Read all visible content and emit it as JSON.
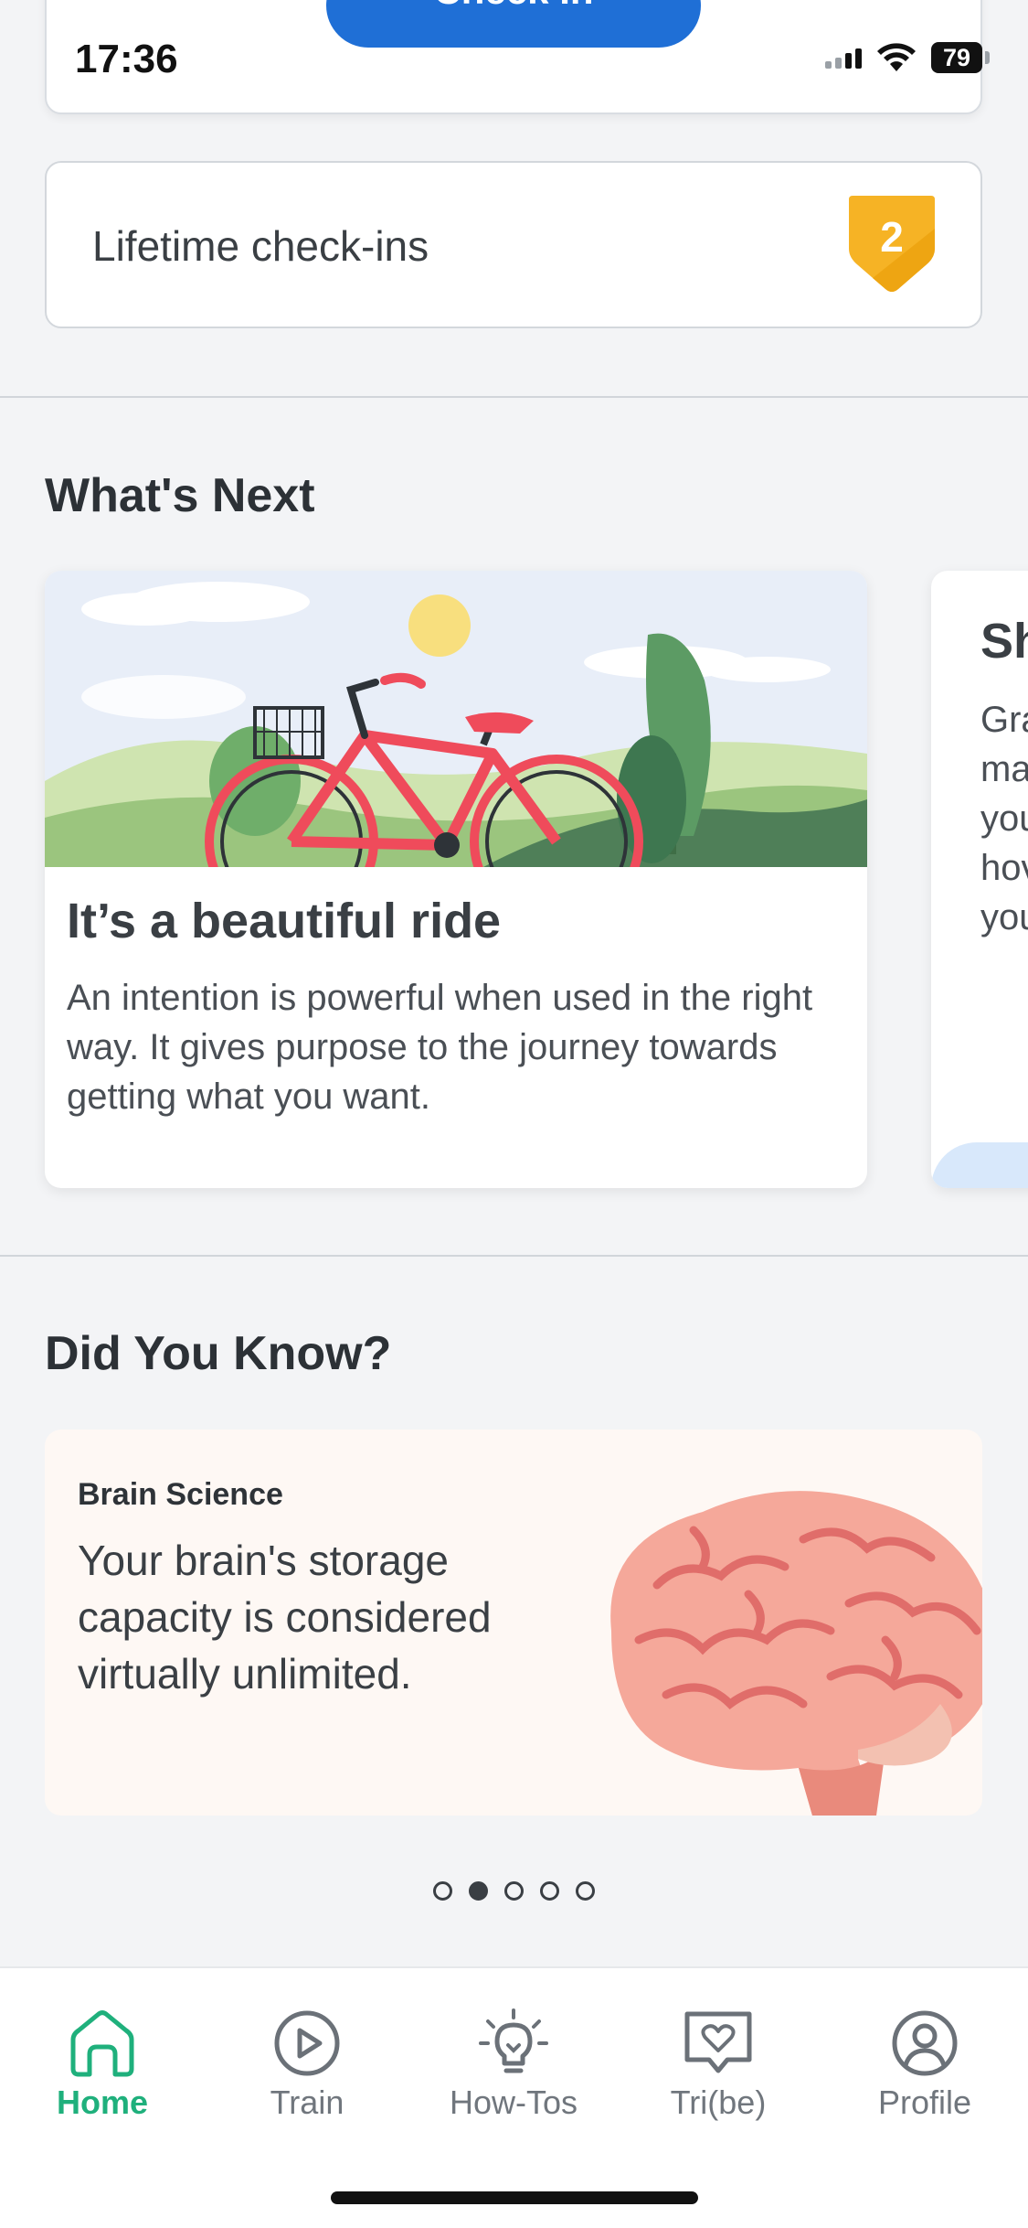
{
  "status_bar": {
    "time": "17:36",
    "battery": "79"
  },
  "checkin": {
    "button_label": "Check In"
  },
  "lifetime": {
    "label": "Lifetime check-ins",
    "count": "2"
  },
  "whats_next": {
    "title": "What's Next",
    "cards": [
      {
        "title": "It’s a beautiful ride",
        "body": "An intention is powerful when used in the right way. It gives purpose to the journey towards getting what you want."
      },
      {
        "title": "Sh",
        "body": "Gra\nma\nyou\nhov\nyou"
      }
    ]
  },
  "did_you_know": {
    "title": "Did You Know?",
    "card": {
      "category": "Brain Science",
      "text": "Your brain's storage capacity is considered virtually unlimited."
    },
    "pager": {
      "count": 5,
      "active_index": 1
    }
  },
  "tabbar": {
    "tabs": [
      {
        "label": "Home",
        "icon": "home-icon",
        "active": true
      },
      {
        "label": "Train",
        "icon": "play-circle-icon",
        "active": false
      },
      {
        "label": "How-Tos",
        "icon": "lightbulb-icon",
        "active": false
      },
      {
        "label": "Tri(be)",
        "icon": "heart-chat-icon",
        "active": false
      },
      {
        "label": "Profile",
        "icon": "profile-icon",
        "active": false
      }
    ]
  },
  "colors": {
    "accent": "#1fb07c",
    "checkin_button": "#1f6fd6",
    "badge": "#f6b325",
    "background": "#f3f4f6"
  }
}
